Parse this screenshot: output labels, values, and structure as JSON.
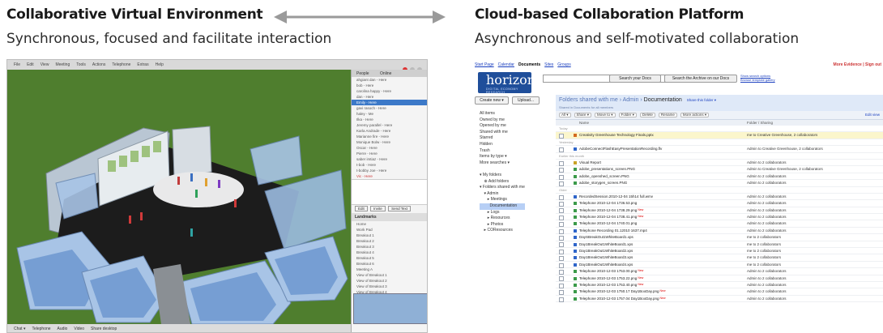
{
  "left": {
    "title": "Collaborative Virtual Environment",
    "subtitle": "Synchronous, focused and facilitate interaction",
    "menu": [
      "File",
      "Edit",
      "View",
      "Meeting",
      "Tools",
      "Actions",
      "Telephone",
      "Extras",
      "Help"
    ],
    "side_tabs": [
      "People",
      "Online"
    ],
    "people": [
      {
        "label": "ahgiant dan - Here",
        "state": "normal"
      },
      {
        "label": "bob - Here",
        "state": "normal"
      },
      {
        "label": "carolina happy - Here",
        "state": "normal"
      },
      {
        "label": "dan - Here",
        "state": "normal"
      },
      {
        "label": "Emily - Here",
        "state": "selected"
      },
      {
        "label": "gavi rasoch - Here",
        "state": "normal"
      },
      {
        "label": "haley - Me",
        "state": "normal"
      },
      {
        "label": "Ilka - Here",
        "state": "normal"
      },
      {
        "label": "Jeremy parallel - Here",
        "state": "normal"
      },
      {
        "label": "Karla Andrade - Here",
        "state": "normal"
      },
      {
        "label": "Marianne fire - Here",
        "state": "normal"
      },
      {
        "label": "Monique Bolw - Here",
        "state": "normal"
      },
      {
        "label": "Oscar - Here",
        "state": "normal"
      },
      {
        "label": "Pierre - Here",
        "state": "normal"
      },
      {
        "label": "saber imtiaz - Here",
        "state": "normal"
      },
      {
        "label": "t-bob - Here",
        "state": "normal"
      },
      {
        "label": "t-bobby Joe - Here",
        "state": "normal"
      },
      {
        "label": "Vic - Here",
        "state": "red"
      }
    ],
    "side_section_label": "Landmarks",
    "side_landmarks": [
      "Home",
      "Work Pad",
      "Breakout 1",
      "Breakout 2",
      "Breakout 3",
      "Breakout 4",
      "Breakout 5",
      "Breakout 6",
      "Meeting A",
      "View of Breakout 1",
      "View of Breakout 2",
      "View of Breakout 3",
      "View of Breakout 4"
    ],
    "side_buttons": [
      "Edit",
      "Invite",
      "Send Text"
    ],
    "status": [
      "Chat ▾",
      "Telephone",
      "Audio",
      "Video",
      "Share desktop"
    ]
  },
  "arrow_label": "",
  "right": {
    "title": "Cloud-based Collaboration Platform",
    "subtitle": "Asynchronous and self-motivated collaboration",
    "top_links": [
      "Start Page",
      "Calendar",
      "Documents",
      "Sites",
      "Groups"
    ],
    "top_current": "Documents",
    "top_right": "More Evidence | Sign out",
    "logo_text": "horizon",
    "logo_sub": "DIGITAL ECONOMY RESEARCH",
    "search_buttons": [
      "Search your Docs",
      "Search the Archive on our Docs"
    ],
    "search_links": [
      "Show search options",
      "Browse template gallery"
    ],
    "left_buttons": [
      "Create new ▾",
      "Upload..."
    ],
    "nav": [
      {
        "label": "All items",
        "hi": false
      },
      {
        "label": "Owned by me",
        "hi": false
      },
      {
        "label": "Opened by me",
        "hi": false
      },
      {
        "label": "Shared with me",
        "hi": false
      },
      {
        "label": "Starred",
        "hi": false
      },
      {
        "label": "Hidden",
        "hi": false
      },
      {
        "label": "Trash",
        "hi": false
      },
      {
        "label": "Items by type ▾",
        "hi": false
      },
      {
        "label": "More searches ▾",
        "hi": false
      },
      {
        "label": "",
        "hi": false
      },
      {
        "label": "▾ My folders",
        "hi": false
      },
      {
        "label": "    ⊕ Add folders",
        "hi": false
      },
      {
        "label": "▾ Folders shared with me",
        "hi": false
      },
      {
        "label": "    ▾ Admin",
        "hi": false
      },
      {
        "label": "       ▸ Meetings",
        "hi": false
      },
      {
        "label": "         Documentation",
        "hi": true
      },
      {
        "label": "       ▸ Logs",
        "hi": false
      },
      {
        "label": "       ▸ Resources",
        "hi": false
      },
      {
        "label": "       ▸ Photos",
        "hi": false
      },
      {
        "label": "    ▸ COResources",
        "hi": false
      }
    ],
    "folder_path_prefix": "Folders shared with me › Admin ›",
    "folder_current": "Documentation",
    "folder_share": "Share this folder ▾",
    "folder_sub": "Shared in Documents for all members",
    "toolbar": [
      "All ▾",
      "Share ▾",
      "Move to ▾",
      "Folder ▾",
      "Delete",
      "Rename",
      "More actions ▾"
    ],
    "toolbar_right": "Edit view",
    "col_name": "Name",
    "col_owner": "Folder / Sharing",
    "rows": [
      {
        "type": "section",
        "name": "Today"
      },
      {
        "type": "file",
        "name": "Creativity Greenhouse Technology Finals.pptx",
        "owner": "me  to Creative Greenhouse, 2 collaborators",
        "hl": true,
        "kind": "ppt",
        "new": false
      },
      {
        "type": "section",
        "name": "Yesterday"
      },
      {
        "type": "file",
        "name": "AdobeConnectFlashEasyPresentationRecording.flv",
        "owner": "Admin  to Creative Greenhouse, 2 collaborators",
        "kind": "doc",
        "new": false
      },
      {
        "type": "section",
        "name": "Earlier this month"
      },
      {
        "type": "file",
        "name": "Visual Report",
        "owner": "Admin  to 2 collaborators",
        "kind": "folder",
        "new": false
      },
      {
        "type": "file",
        "name": "adobe_presentations_screen.PNG",
        "owner": "Admin  to Creative Greenhouse, 2 collaborators",
        "kind": "img",
        "new": false
      },
      {
        "type": "file",
        "name": "adobe_openshed_screen.PNG",
        "owner": "Admin  to 2 collaborators",
        "kind": "img",
        "new": false
      },
      {
        "type": "file",
        "name": "adobe_storygen_screen.PNG",
        "owner": "Admin  to 2 collaborators",
        "kind": "img",
        "new": false
      },
      {
        "type": "section",
        "name": "Older"
      },
      {
        "type": "file",
        "name": "RecordedSession.2010-12-04 15h14 full.wmv",
        "owner": "Admin  to 2 collaborators",
        "kind": "doc",
        "new": false
      },
      {
        "type": "file",
        "name": "Telephone 2010-12-04 1736.53.png",
        "owner": "Admin  to 2 collaborators",
        "kind": "img",
        "new": false
      },
      {
        "type": "file",
        "name": "Telephone 2010-12-04 1738.29.png",
        "owner": "Admin  to 2 collaborators",
        "kind": "img",
        "new": true
      },
      {
        "type": "file",
        "name": "Telephone 2010-12-04 1738.41.png",
        "owner": "Admin  to 2 collaborators",
        "kind": "img",
        "new": true
      },
      {
        "type": "file",
        "name": "Telephone 2010-12-04 1740.01.png",
        "owner": "Admin  to 2 collaborators",
        "kind": "img",
        "new": false
      },
      {
        "type": "file",
        "name": "Telephone Recording 01.12010 1637.mp4",
        "owner": "Admin  to 2 collaborators",
        "kind": "doc",
        "new": false
      },
      {
        "type": "file",
        "name": "DaySBreakOut1WhiteBoard1.xps",
        "owner": "me  to 2 collaborators",
        "kind": "doc",
        "new": false
      },
      {
        "type": "file",
        "name": "Day1BreakOut1WhiteBoard1.xps",
        "owner": "me  to 2 collaborators",
        "kind": "doc",
        "new": false
      },
      {
        "type": "file",
        "name": "Day1BreakOut1WhiteBoard2.xps",
        "owner": "me  to 2 collaborators",
        "kind": "doc",
        "new": false
      },
      {
        "type": "file",
        "name": "Day1BreakOut1WhiteBoard3.xps",
        "owner": "me  to 2 collaborators",
        "kind": "doc",
        "new": false
      },
      {
        "type": "file",
        "name": "Day1BreakOut1WhiteBoard4.xps",
        "owner": "me  to 2 collaborators",
        "kind": "doc",
        "new": false
      },
      {
        "type": "file",
        "name": "Telephone 2010-12-03 1753.00.png",
        "owner": "Admin  to 2 collaborators",
        "kind": "img",
        "new": true
      },
      {
        "type": "file",
        "name": "Telephone 2010-12-03 1753.22.png",
        "owner": "Admin  to 2 collaborators",
        "kind": "img",
        "new": true
      },
      {
        "type": "file",
        "name": "Telephone 2010-12-03 1753.40.png",
        "owner": "Admin  to 2 collaborators",
        "kind": "img",
        "new": true
      },
      {
        "type": "file",
        "name": "Telephone 2010-12-03 1750.17 Day1BoxDay.png",
        "owner": "Admin  to 2 collaborators",
        "kind": "img",
        "new": true
      },
      {
        "type": "file",
        "name": "Telephone 2010-12-03 1757.04 Day1BoxDay.png",
        "owner": "Admin  to 2 collaborators",
        "kind": "img",
        "new": true
      }
    ],
    "new_label": "New"
  },
  "colors": {
    "portal_blue": "#1f4e9a",
    "selection": "#3c79c8",
    "highlight_row": "#fbf6cc",
    "floor": "#1c1c1c",
    "ground": "#4f7e2e"
  }
}
